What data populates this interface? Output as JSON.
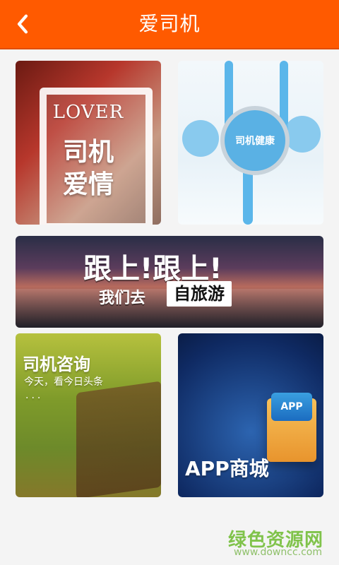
{
  "header": {
    "title": "爱司机",
    "back_icon": "chevron-left-icon",
    "bg_color": "#ff5a00"
  },
  "tiles": {
    "lover": {
      "en": "LOVER",
      "line1": "司机",
      "line2": "爱情"
    },
    "health": {
      "label": "司机健康"
    },
    "trip": {
      "line1": "跟上!跟上!",
      "line2_prefix": "我们去",
      "line2_box": "自旅游"
    },
    "consult": {
      "title": "司机咨询",
      "subtitle": "今天，看今日头条",
      "dots": "..."
    },
    "store": {
      "label": "APP商城",
      "box_text": "APP"
    }
  },
  "watermark": {
    "cn": "绿色资源网",
    "url": "www.downcc.com",
    "color": "#7ac142"
  }
}
